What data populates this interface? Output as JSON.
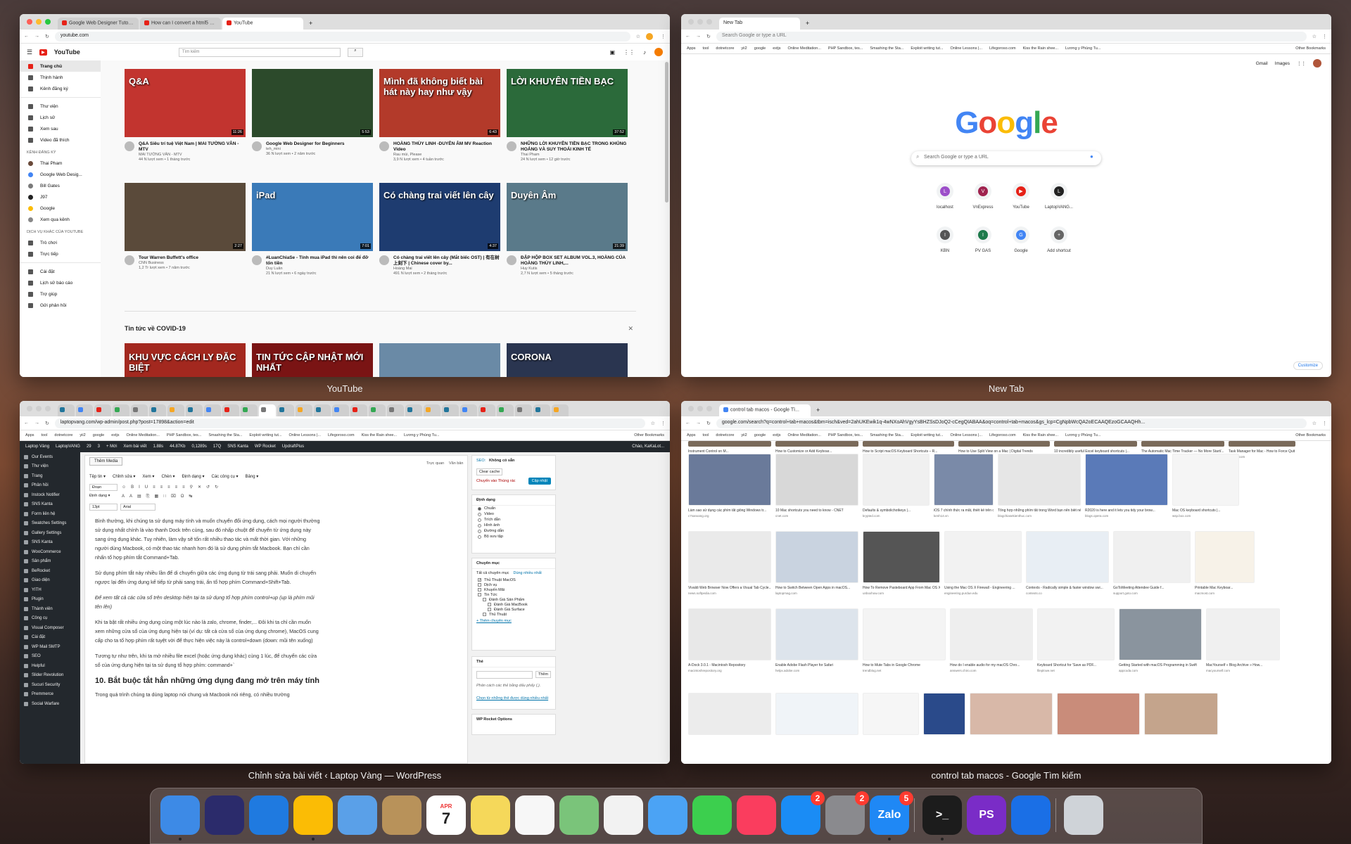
{
  "windows": {
    "youtube": {
      "caption": "YouTube",
      "tabs": [
        "Google Web Designer Tutori...",
        "How can I convert a html5 ba...",
        "YouTube"
      ],
      "url": "youtube.com",
      "search_placeholder": "Tìm kiếm",
      "sidebar": [
        {
          "label": "Trang chủ",
          "active": true
        },
        {
          "label": "Thịnh hành"
        },
        {
          "label": "Kênh đăng ký"
        },
        {
          "label": "Thư viện"
        },
        {
          "label": "Lịch sử"
        },
        {
          "label": "Xem sau"
        },
        {
          "label": "Video đã thích"
        }
      ],
      "subs_header": "KÊNH ĐĂNG KÝ",
      "subs": [
        "Thai Pham",
        "Google Web Desig...",
        "Bill Gates",
        "J97",
        "Google",
        "Xem qua kênh"
      ],
      "more_header": "DỊCH VỤ KHÁC CỦA YOUTUBE",
      "more": [
        "Trò chơi",
        "Trực tiếp"
      ],
      "footer_items": [
        "Cài đặt",
        "Lịch sử báo cáo",
        "Trợ giúp",
        "Gửi phản hồi"
      ],
      "videos": [
        {
          "title": "Q&A Siêu trí tuệ Việt Nam | MAI TƯỜNG VÂN - MTV",
          "channel": "MAI TƯỜNG VÂN - MTV",
          "meta": "44 N lượt xem • 1 tháng trước",
          "dur": "11:26",
          "color": "#c2342f"
        },
        {
          "title": "Google Web Designer for Beginners",
          "channel": "teh_mini",
          "meta": "36 N lượt xem • 2 năm trước",
          "dur": "5:53",
          "color": "#2c4a2b"
        },
        {
          "title": "HOÀNG THÙY LINH -DUYÊN ÂM MV Reaction Video",
          "channel": "Rau mùi, Please",
          "meta": "3,9 N lượt xem • 4 tuần trước",
          "dur": "6:43",
          "color": "#b33a2a"
        },
        {
          "title": "NHỮNG LỜI KHUYÊN TIỀN BẠC TRONG KHỦNG HOẢNG VÀ SUY THOÁI KINH TẾ",
          "channel": "Thai Pham",
          "meta": "24 N lượt xem • 12 giờ trước",
          "dur": "37:52",
          "color": "#2b6a3a"
        },
        {
          "title": "Tour Warren Buffett's office",
          "channel": "CNN Business",
          "meta": "1,2 Tr lượt xem • 7 năm trước",
          "dur": "2:27",
          "color": "#5a4a3a"
        },
        {
          "title": "#LuanChiaSe - Tính mua iPad thì nên coi để đỡ tốn tiền",
          "channel": "Duy Luân",
          "meta": "21 N lượt xem • 6 ngày trước",
          "dur": "7:01",
          "color": "#3a7ab8"
        },
        {
          "title": "Có chàng trai viết lên cây (Mắt biếc OST) | 有在树上刻下 | Chinese cover by...",
          "channel": "Hoàng Mai",
          "meta": "491 N lượt xem • 2 tháng trước",
          "dur": "4:37",
          "color": "#1e3c70"
        },
        {
          "title": "ĐẬP HỘP BOX SET ALBUM VOL.3, HOÀNG CỦA HOÀNG THÙY LINH,...",
          "channel": "Huy Kutis",
          "meta": "2,7 N lượt xem • 5 tháng trước",
          "dur": "21:39",
          "color": "#5a7a8a"
        }
      ],
      "thumb_texts": [
        "Q&A",
        "",
        "Mình đã không biết bài hát này hay như vậy",
        "LỜI KHUYÊN TIỀN BẠC",
        "",
        "iPad",
        "Có chàng trai viết lên cây",
        "Duyên Âm"
      ],
      "covid_title": "Tin tức về COVID-19",
      "covid_thumbs": [
        {
          "text": "KHU VỰC CÁCH LY ĐẶC BIỆT",
          "color": "#a3281f"
        },
        {
          "text": "TIN TỨC CẬP NHẬT MỚI NHẤT",
          "color": "#7a1414"
        },
        {
          "text": "",
          "color": "#6a8aa6"
        },
        {
          "text": "CORONA",
          "color": "#2a3550"
        }
      ]
    },
    "newtab": {
      "caption": "New Tab",
      "tab": "New Tab",
      "url_placeholder": "Search Google or type a URL",
      "bookmarks": [
        "Apps",
        "tool",
        "dotnetcore",
        "yii2",
        "google",
        "extjs",
        "Online Meditation...",
        "PHP Sandbox, tes...",
        "Smashing the Sta...",
        "Exploit writing tut...",
        "Online Lessons |...",
        "Lifegoroso.com",
        "Kiss the Rain shee...",
        "Lương y Phùng Tu..."
      ],
      "other_bookmarks": "Other Bookmarks",
      "top_links": [
        "Gmail",
        "Images"
      ],
      "logo": "Google",
      "search_placeholder": "Search Google or type a URL",
      "shortcuts": [
        {
          "label": "localhost",
          "letter": "L",
          "color": "#9c4ec9"
        },
        {
          "label": "VnExpress",
          "letter": "V",
          "color": "#9f224e"
        },
        {
          "label": "YouTube",
          "letter": "▶",
          "color": "#e62117"
        },
        {
          "label": "LaptopVANG...",
          "letter": "L",
          "color": "#222"
        },
        {
          "label": "KBN",
          "letter": "I",
          "color": "#555"
        },
        {
          "label": "PV GAS",
          "letter": "I",
          "color": "#1d7a4b"
        },
        {
          "label": "Google",
          "letter": "G",
          "color": "#4285f4"
        },
        {
          "label": "Add shortcut",
          "letter": "+",
          "color": "#666"
        }
      ],
      "customize": "Customize"
    },
    "wordpress": {
      "caption": "Chỉnh sửa bài viết ‹ Laptop Vàng — WordPress",
      "url": "laptopvang.com/wp-admin/post.php?post=17898&action=edit",
      "adminbar": [
        "Laptop Vàng",
        "LaptopVANG",
        "29",
        "3",
        "+ Mới",
        "Xem bài viết",
        "1.88s",
        "44.87Kb",
        "0,1289s",
        "17Q",
        "SNS Kanta",
        "WP Rocket",
        "UpdraftPlus"
      ],
      "greeting": "Chào, KaKaLot...",
      "sidebar": [
        "Our Events",
        "Thư viện",
        "Trang",
        "Phản hồi",
        "Instock Notifier",
        "SNS Kanta",
        "Form liên hệ",
        "Swatches Settings",
        "Gallery Settings",
        "SNS Kanta",
        "WooCommerce",
        "Sản phẩm",
        "BeRocket",
        "Giao diện",
        "YITH",
        "Plugin",
        "Thành viên",
        "Công cụ",
        "Visual Composer",
        "Cài đặt",
        "WP Mail SMTP",
        "SEO",
        "Helpful",
        "Slider Revolution",
        "Sucuri Security",
        "Premmerce",
        "Social Warfare"
      ],
      "add_media": "Thêm Media",
      "mode_tabs": [
        "Trực quan",
        "Văn bản"
      ],
      "menubar": [
        "Tệp tin",
        "Chỉnh sửa",
        "Xem",
        "Chèn",
        "Định dạng",
        "Các công cụ",
        "Bảng"
      ],
      "fmt": [
        "Đoạn",
        "Định dạng",
        "13pt",
        "Arial"
      ],
      "paragraphs": [
        "Bình thường, khi chúng ta sử dụng máy tính và muốn chuyển đổi ứng dụng, cách mọi người thường sử dụng nhất chính là vào thanh Dock trên cùng, sau đó nhấp chuột để chuyển từ ứng dụng này sang ứng dụng khác. Tuy nhiên, làm vậy sẽ tốn rất nhiều thao tác và mất thời gian. Với những người dùng Macbook, có một thao tác nhanh hơn đó là sử dụng phím tắt Macbook. Bạn chỉ cần nhấn tổ hợp phím tắt Command+Tab.",
        "Sử dụng phím tắt này nhiều lần để di chuyển giữa các ứng dụng từ trái sang phải. Muốn di chuyển ngược lại đến ứng dụng kế tiếp từ phải sang trái, ấn tổ hợp phím Command+Shift+Tab.",
        "Để xem tất cả các cửa sổ trên desktop hiện tại ta sử dụng tổ hợp phím control+up (up là phím mũi tên lên)",
        "Khi ta bật rất nhiều ứng dụng cùng một lúc nào là zalo, chrome, finder,... Đôi khi ta chỉ cần muốn xem những cửa sổ của ứng dụng hiện tại (ví dụ: tất cả cửa sổ của ứng dụng chrome), MacOS cung cấp cho ta tổ hợp phím rất tuyệt vời để thực hiện việc này là control+down (down: mũi tên xuống)",
        "Tương tự như trên, khi ta mở nhiều file excel (hoặc ứng dụng khác) cùng 1 lúc, để chuyển các cửa sổ của ứng dụng hiện tại ta sử dụng tổ hợp phím: command+`"
      ],
      "heading": "10. Bắt buộc tắt hẳn những ứng dụng đang mở trên máy tính",
      "last_line": "Trong quá trình chúng ta dùng laptop nói chung và Macbook nói riêng, có nhiều trường",
      "seo_label": "SEO:",
      "seo_value": "Không có sẵn",
      "clear_cache": "Clear cache",
      "trash": "Chuyển vào Thùng rác",
      "update": "Cập nhật",
      "format_title": "Định dạng",
      "formats": [
        "Chuẩn",
        "Video",
        "Trích dẫn",
        "Hình ảnh",
        "Đường dẫn",
        "Bộ sưu tập"
      ],
      "cat_title": "Chuyên mục",
      "cat_tabs": [
        "Tất cả chuyên mục",
        "Dùng nhiều nhất"
      ],
      "cats": [
        "Thủ Thuật MacOS",
        "Dịch vụ",
        "Khuyến Mãi",
        "Tin Tức",
        "Đánh Giá Sản Phẩm",
        "Đánh Giá MacBook",
        "Đánh Giá Surface",
        "Thủ Thuật"
      ],
      "add_cat": "+ Thêm chuyên mục",
      "tags_title": "Thẻ",
      "tags_add": "Thêm",
      "tags_hint": "Phân cách các thẻ bằng dấu phẩy (,).",
      "tags_link": "Chọn từ những thẻ được dùng nhiều nhất",
      "rocket": "WP Rocket Options"
    },
    "gsearch": {
      "caption": "control tab macos - Google Tìm kiếm",
      "tab": "control tab macos - Google Tì...",
      "url": "google.com/search?q=control+tab+macos&tbm=isch&ved=2ahUKEwik1q-4wNXoAhVgyYsBHZSsDJoQ2-cCegQIABAA&oq=control+tab+macos&gs_lcp=CgNpbWcQA2oECAAQEzoGCAAQHh...",
      "row0": [
        "Instrument Control on M...",
        "How to Customize or Add Keyboar...",
        "How to Script macOS Keyboard Shortcuts – R...",
        "How to Use Split View on a Mac | Digital Trends",
        "10 incredibly useful Excel keyboard shortcuts |...",
        "The Automatic Mac Time Tracker — No More Start/...",
        "Task Manager for Mac - How to Force Quit o..."
      ],
      "row0src": [
        "ni.com",
        "forums.tomsguide.com",
        "rightpoint.com",
        "digitaltrends.com",
        "itworld.com",
        "timingapp.com",
        "setapp.com"
      ],
      "row1": [
        "Làm sao sử dụng các phím tắt giống Windows tr...",
        "10 Mac shortcuts you need to know - CNET",
        "Defaults & symbolichotkeys |...",
        "iOS 7 chính thức ra mắt, thiết kế trên cả...",
        "Tổng hợp những phím tắt trong Word bạn nên biết nếu...",
        "R2020 is here and it lets you tidy your brow...",
        "Mac OS keyboard shortcuts |..."
      ],
      "row1src": [
        "c7sanxang.org",
        "cnet.com",
        "krypted.com",
        "kenh14.vn",
        "blogchiasekienthuc.com",
        "blogs.opera.com",
        "wsp.box.com"
      ],
      "row2": [
        "Vivaldi Web Browser Now Offers a Visual Tab Cycle...",
        "How to Switch Between Open Apps in macOS...",
        "How To Remove Pasteboard App From Mac OS X -...",
        "Using the Mac OS X Firewall - Engineering ...",
        "Contexts - Radically simple & faster window swi...",
        "GoToMeeting Attendee Guide f...",
        "Printable Mac Keyboar..."
      ],
      "row2src": [
        "news.softpedia.com",
        "laptopmag.com",
        "unboxhow.com",
        "engineering.purdue.edu",
        "contexts.co",
        "support.goto.com",
        "macmost.com"
      ],
      "row3": [
        "A-Dock 3.0.1 - Macintosh Repository",
        "Enable Adobe Flash Player for Safari",
        "How to Mute Tabs in Google Chrome",
        "How do I enable audio for my macOS Chro...",
        "Keyboard Shortcut for 'Save as PDF...",
        "Getting Started with macOS Programming in Swift",
        "MacYourself » Blog Archive » How..."
      ],
      "row3src": [
        "macintoshrepository.org",
        "helpx.adobe.com",
        "trendblog.net",
        "answers.chiro.com",
        "fileplcwe.net",
        "appcoda.com",
        "macyourself.com"
      ]
    }
  },
  "dock": [
    {
      "name": "finder-icon",
      "color": "#3d8ae6",
      "label": ""
    },
    {
      "name": "siri-icon",
      "color": "#2b2b6b",
      "label": ""
    },
    {
      "name": "safari-icon",
      "color": "#1f7ae0",
      "label": ""
    },
    {
      "name": "chrome-icon",
      "color": "#fbbc05",
      "label": ""
    },
    {
      "name": "mail-icon",
      "color": "#5aa0e8",
      "label": ""
    },
    {
      "name": "contacts-icon",
      "color": "#b8925a",
      "label": ""
    },
    {
      "name": "calendar-icon",
      "color": "#ffffff",
      "label": "7",
      "sub": "APR"
    },
    {
      "name": "notes-icon",
      "color": "#f5d85a",
      "label": ""
    },
    {
      "name": "reminders-icon",
      "color": "#f7f7f7",
      "label": ""
    },
    {
      "name": "maps-icon",
      "color": "#7ac47a",
      "label": ""
    },
    {
      "name": "photos-icon",
      "color": "#f2f2f2",
      "label": ""
    },
    {
      "name": "messages-icon",
      "color": "#4ba3f5",
      "label": ""
    },
    {
      "name": "facetime-icon",
      "color": "#3ccf4e",
      "label": ""
    },
    {
      "name": "music-icon",
      "color": "#fa3d5e",
      "label": ""
    },
    {
      "name": "appstore-icon",
      "color": "#1a8cf5",
      "label": "",
      "badge": "2"
    },
    {
      "name": "settings-icon",
      "color": "#8a8a8e",
      "label": "",
      "badge": "2"
    },
    {
      "name": "zalo-icon",
      "color": "#1f88f5",
      "label": "Zalo",
      "badge": "5"
    },
    {
      "name": "terminal-icon",
      "color": "#1c1c1c",
      "label": ">_"
    },
    {
      "name": "phpstorm-icon",
      "color": "#7a2cc7",
      "label": "PS"
    },
    {
      "name": "teamviewer-icon",
      "color": "#1a6fe6",
      "label": ""
    },
    {
      "name": "trash-icon",
      "color": "#cfd3d8",
      "label": ""
    }
  ]
}
